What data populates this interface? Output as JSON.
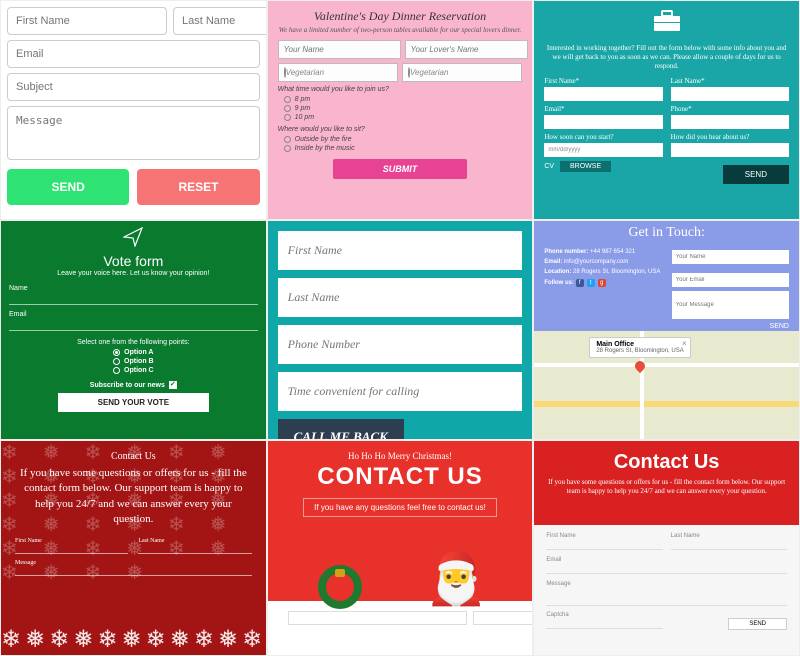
{
  "t1": {
    "first_name": "First Name",
    "last_name": "Last Name",
    "email": "Email",
    "subject": "Subject",
    "message": "Message",
    "send": "SEND",
    "reset": "RESET"
  },
  "t2": {
    "title": "Valentine's Day Dinner Reservation",
    "subtitle": "We have a limited number of two-person tables available for our special lovers dinner.",
    "your_name": "Your Name",
    "lover_name": "Your Lover's Name",
    "veg1": "Vegetarian",
    "veg2": "Vegetarian",
    "q_time": "What time would you like to join us?",
    "opts_time": [
      "8 pm",
      "9 pm",
      "10 pm"
    ],
    "q_seat": "Where would you like to sit?",
    "opts_seat": [
      "Outside by the fire",
      "Inside by the music"
    ],
    "submit": "SUBMIT"
  },
  "t3": {
    "intro": "Interested in working together? Fill out the form below with some info about you and we will get back to you as soon as we can. Please allow a couple of days for us to respond.",
    "first_name": "First Name*",
    "last_name": "Last Name*",
    "email": "Email*",
    "phone": "Phone*",
    "start": "How soon can you start?",
    "hear": "How did you hear about us?",
    "start_val": "mm/dd/yyyy",
    "cv": "CV",
    "browse": "BROWSE",
    "send": "SEND"
  },
  "t4": {
    "title": "Vote form",
    "subtitle": "Leave your voice here. Let us know your opinion!",
    "name": "Name",
    "email": "Email",
    "select": "Select one from the following points:",
    "options": [
      "Option A",
      "Option B",
      "Option C"
    ],
    "subscribe": "Subscribe to our news",
    "submit": "SEND YOUR VOTE"
  },
  "t5": {
    "first_name": "First Name",
    "last_name": "Last Name",
    "phone": "Phone Number",
    "time": "Time convenient for calling",
    "button": "CALL ME BACK"
  },
  "t6": {
    "title": "Get in Touch:",
    "phone_k": "Phone number:",
    "phone_v": "+44 987 654 321",
    "email_k": "Email:",
    "email_v": "info@yourcompany.com",
    "loc_k": "Location:",
    "loc_v": "28 Rogers St, Bloomington, USA",
    "follow": "Follow us:",
    "ph_name": "Your Name",
    "ph_email": "Your Email",
    "ph_msg": "Your Message",
    "send": "SEND",
    "bubble_title": "Main Office",
    "bubble_addr": "28 Rogers St, Bloomington, USA"
  },
  "t7": {
    "title": "Contact Us",
    "text": "If you have some questions or offers for us - fill the contact form below. Our support team is happy to help you 24/7 and we can answer every your question.",
    "first_name": "First Name",
    "last_name": "Last Name",
    "message": "Message"
  },
  "t8": {
    "ho": "Ho Ho Ho Merry Christmas!",
    "title": "CONTACT US",
    "subtitle": "If you have any questions feel free to contact us!"
  },
  "t9": {
    "title": "Contact Us",
    "text": "If you have some questions or offers for us - fill the contact form below. Our support team is happy to help you 24/7 and we can answer every your question.",
    "first_name": "First Name",
    "last_name": "Last Name",
    "email": "Email",
    "message": "Message",
    "captcha": "Captcha",
    "send": "SEND"
  }
}
